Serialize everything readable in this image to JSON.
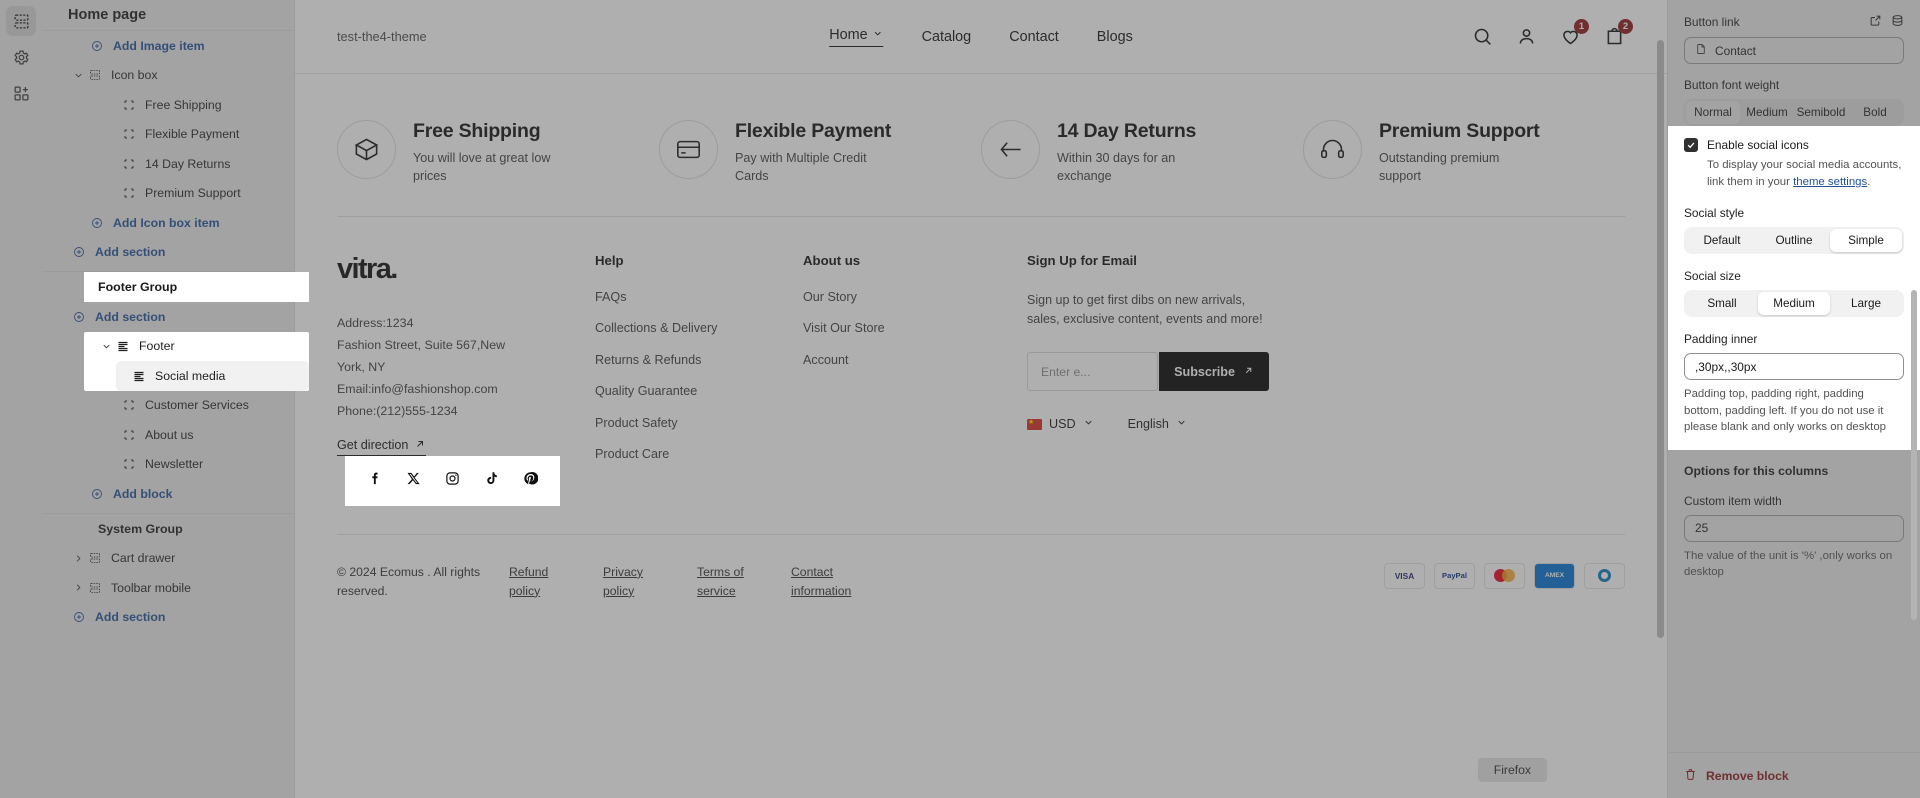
{
  "rail": {
    "items": [
      {
        "name": "sections-icon",
        "selected": true
      },
      {
        "name": "gear-icon",
        "selected": false
      },
      {
        "name": "apps-add-icon",
        "selected": false
      }
    ]
  },
  "sidebar": {
    "title": "Home page",
    "tree": [
      {
        "label": "Add Image item",
        "type": "add",
        "indent": 1
      },
      {
        "label": "Icon box",
        "type": "section",
        "indent": 0,
        "twisty": "down"
      },
      {
        "label": "Free Shipping",
        "type": "block",
        "indent": 2
      },
      {
        "label": "Flexible Payment",
        "type": "block",
        "indent": 2
      },
      {
        "label": "14 Day Returns",
        "type": "block",
        "indent": 2
      },
      {
        "label": "Premium Support",
        "type": "block",
        "indent": 2
      },
      {
        "label": "Add Icon box item",
        "type": "add",
        "indent": 1
      },
      {
        "label": "Add section",
        "type": "add",
        "indent": 0
      }
    ],
    "footer_group_label": "Footer Group",
    "footer_group_add": "Add section",
    "footer_label": "Footer",
    "footer_blocks": [
      {
        "label": "Social media",
        "selected": true
      },
      {
        "label": "Customer Services",
        "selected": false
      },
      {
        "label": "About us",
        "selected": false
      },
      {
        "label": "Newsletter",
        "selected": false
      }
    ],
    "footer_add_block": "Add block",
    "system_group_label": "System Group",
    "system_items": [
      {
        "label": "Cart drawer"
      },
      {
        "label": "Toolbar mobile"
      }
    ],
    "system_add": "Add section"
  },
  "preview": {
    "shop_name": "test-the4-theme",
    "nav": [
      {
        "label": "Home",
        "active": true,
        "caret": true
      },
      {
        "label": "Catalog",
        "active": false,
        "caret": false
      },
      {
        "label": "Contact",
        "active": false,
        "caret": false
      },
      {
        "label": "Blogs",
        "active": false,
        "caret": false
      }
    ],
    "nav_icons": [
      {
        "name": "search-icon",
        "badge": ""
      },
      {
        "name": "account-icon",
        "badge": ""
      },
      {
        "name": "wishlist-heart-icon",
        "badge": "1"
      },
      {
        "name": "cart-bag-icon",
        "badge": "2"
      }
    ],
    "icon_boxes": [
      {
        "icon": "box-icon",
        "title": "Free Shipping",
        "desc": "You will love at great low prices"
      },
      {
        "icon": "card-icon",
        "title": "Flexible Payment",
        "desc": "Pay with Multiple Credit Cards"
      },
      {
        "icon": "return-arrow-icon",
        "title": "14 Day Returns",
        "desc": "Within 30 days for an exchange"
      },
      {
        "icon": "headset-icon",
        "title": "Premium Support",
        "desc": "Outstanding premium support"
      }
    ],
    "footer": {
      "logo": "vitra.",
      "address_lines": [
        "Address:1234",
        "Fashion Street, Suite 567,New York, NY",
        "Email:info@fashionshop.com",
        "Phone:(212)555-1234"
      ],
      "get_direction": "Get direction",
      "columns": [
        {
          "heading": "Help",
          "links": [
            "FAQs",
            "Collections & Delivery",
            "Returns & Refunds",
            "Quality Guarantee",
            "Product Safety",
            "Product Care"
          ]
        },
        {
          "heading": "About us",
          "links": [
            "Our Story",
            "Visit Our Store",
            "Account"
          ]
        }
      ],
      "newsletter": {
        "heading": "Sign Up for Email",
        "text": "Sign up to get first dibs on new arrivals, sales, exclusive content, events and more!",
        "placeholder": "Enter e...",
        "button": "Subscribe"
      },
      "social": [
        "facebook-icon",
        "x-twitter-icon",
        "instagram-icon",
        "tiktok-icon",
        "pinterest-icon"
      ],
      "currency": "USD",
      "language": "English",
      "copyright": "© 2024 Ecomus . All rights reserved.",
      "legal": [
        "Refund policy",
        "Privacy policy",
        "Terms of service",
        "Contact information"
      ],
      "payments": [
        "VISA",
        "PayPal",
        "mastercard",
        "AMEX",
        "Diners"
      ]
    },
    "firefox_button": "Firefox"
  },
  "settings": {
    "button_link_label": "Button link",
    "button_link_value": "Contact",
    "button_font_weight_label": "Button font weight",
    "button_font_weight_options": [
      "Normal",
      "Medium",
      "Semibold",
      "Bold"
    ],
    "button_font_weight_selected": "Normal",
    "enable_social_label": "Enable social icons",
    "enable_social_checked": true,
    "enable_social_help_1": "To display your social media accounts, link them in your ",
    "enable_social_help_link": "theme settings",
    "enable_social_help_2": ".",
    "social_style_label": "Social style",
    "social_style_options": [
      "Default",
      "Outline",
      "Simple"
    ],
    "social_style_selected": "Simple",
    "social_size_label": "Social size",
    "social_size_options": [
      "Small",
      "Medium",
      "Large"
    ],
    "social_size_selected": "Medium",
    "padding_inner_label": "Padding inner",
    "padding_inner_value": ",30px,,30px",
    "padding_inner_help": "Padding top, padding right, padding bottom, padding left. If you do not use it please blank and only works on desktop",
    "options_columns_label": "Options for this columns",
    "custom_item_width_label": "Custom item width",
    "custom_item_width_value": "25",
    "custom_item_width_help": "The value of the unit is '%' ,only works on desktop",
    "remove_block_label": "Remove block"
  },
  "colors": {
    "accent_blue": "#1f5199",
    "danger_red": "#8c1515",
    "panel_bg": "#e9e9e9"
  }
}
